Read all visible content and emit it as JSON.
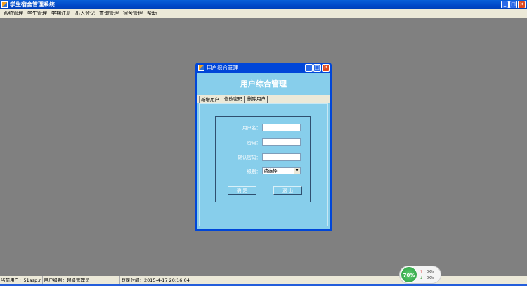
{
  "app": {
    "title": "学生宿舍管理系统"
  },
  "menu": [
    "系统管理",
    "学生管理",
    "学期注册",
    "出入登记",
    "查询管理",
    "宿舍管理",
    "帮助"
  ],
  "dialog": {
    "title": "用户综合管理",
    "heading": "用户综合管理",
    "tabs": [
      "新增用户",
      "修改密码",
      "删除用户"
    ],
    "labels": {
      "username": "用户名：",
      "password": "密码：",
      "confirm": "确认密码：",
      "level": "级别："
    },
    "level_value": "请选择",
    "ok": "确 定",
    "exit": "退 出"
  },
  "status": {
    "user": "当前用户：51asp.n",
    "level": "用户级别：超级管理员",
    "login": "登录时间：2015-4-17 20:16:04"
  },
  "net": {
    "percent": "70%",
    "up": "0K/s",
    "down": "0K/s"
  }
}
